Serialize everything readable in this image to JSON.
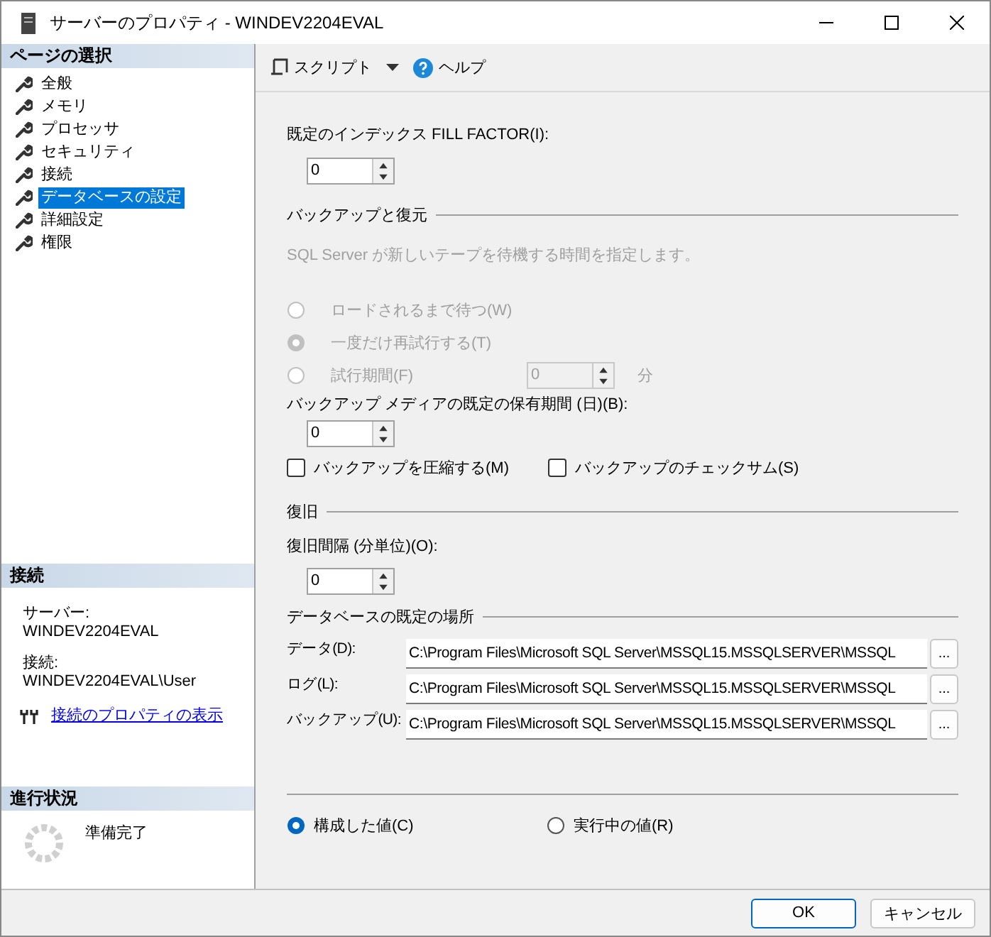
{
  "window": {
    "title": "サーバーのプロパティ - WINDEV2204EVAL"
  },
  "page_select": {
    "heading": "ページの選択",
    "items": [
      {
        "label": "全般",
        "selected": false
      },
      {
        "label": "メモリ",
        "selected": false
      },
      {
        "label": "プロセッサ",
        "selected": false
      },
      {
        "label": "セキュリティ",
        "selected": false
      },
      {
        "label": "接続",
        "selected": false
      },
      {
        "label": "データベースの設定",
        "selected": true
      },
      {
        "label": "詳細設定",
        "selected": false
      },
      {
        "label": "権限",
        "selected": false
      }
    ]
  },
  "connection": {
    "heading": "接続",
    "server_label": "サーバー:",
    "server_value": "WINDEV2204EVAL",
    "connection_label": "接続:",
    "connection_value": "WINDEV2204EVAL\\User",
    "link": "接続のプロパティの表示"
  },
  "progress": {
    "heading": "進行状況",
    "status": "準備完了"
  },
  "toolbar": {
    "script": "スクリプト",
    "help": "ヘルプ"
  },
  "fill_factor": {
    "label": "既定のインデックス FILL FACTOR(I):",
    "value": "0"
  },
  "backup": {
    "heading": "バックアップと復元",
    "description": "SQL Server が新しいテープを待機する時間を指定します。",
    "description_disabled": true,
    "radios": [
      {
        "label": "ロードされるまで待つ(W)",
        "selected": false,
        "disabled": true
      },
      {
        "label": "一度だけ再試行する(T)",
        "selected": true,
        "disabled": true
      },
      {
        "label": "試行期間(F)",
        "selected": false,
        "disabled": true
      }
    ],
    "retry_value": "0",
    "retry_disabled": true,
    "retry_unit": "分",
    "retention_label": "バックアップ メディアの既定の保有期間 (日)(B):",
    "retention_value": "0",
    "checkboxes": [
      {
        "label": "バックアップを圧縮する(M)",
        "checked": false
      },
      {
        "label": "バックアップのチェックサム(S)",
        "checked": false
      }
    ]
  },
  "recovery": {
    "heading": "復旧",
    "label": "復旧間隔 (分単位)(O):",
    "value": "0"
  },
  "locations": {
    "heading": "データベースの既定の場所",
    "rows": [
      {
        "label": "データ(D):",
        "path": "C:\\Program Files\\Microsoft SQL Server\\MSSQL15.MSSQLSERVER\\MSSQL",
        "browse": "..."
      },
      {
        "label": "ログ(L):",
        "path": "C:\\Program Files\\Microsoft SQL Server\\MSSQL15.MSSQLSERVER\\MSSQL",
        "browse": "..."
      },
      {
        "label": "バックアップ(U):",
        "path": "C:\\Program Files\\Microsoft SQL Server\\MSSQL15.MSSQLSERVER\\MSSQL",
        "browse": "..."
      }
    ]
  },
  "value_mode": [
    {
      "label": "構成した値(C)",
      "selected": true
    },
    {
      "label": "実行中の値(R)",
      "selected": false
    }
  ],
  "buttons": [
    {
      "label": "OK",
      "default": true
    },
    {
      "label": "キャンセル",
      "default": false
    }
  ]
}
